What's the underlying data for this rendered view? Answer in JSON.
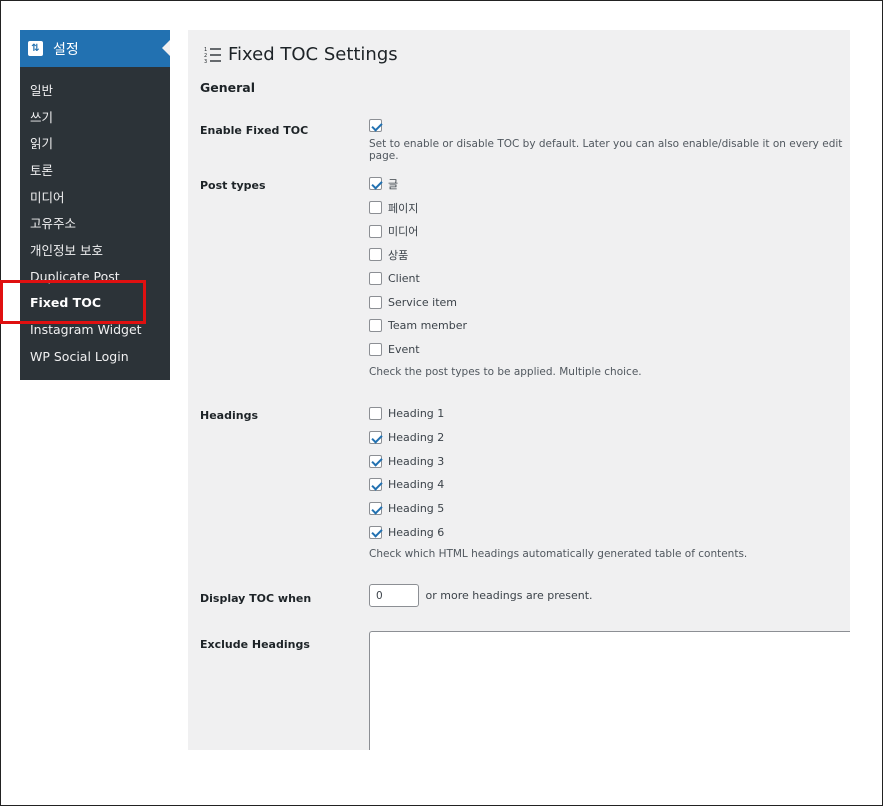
{
  "sidebar": {
    "header_label": "설정",
    "header_icon": "settings-icon",
    "items": [
      {
        "label": "일반"
      },
      {
        "label": "쓰기"
      },
      {
        "label": "읽기"
      },
      {
        "label": "토론"
      },
      {
        "label": "미디어"
      },
      {
        "label": "고유주소"
      },
      {
        "label": "개인정보 보호"
      },
      {
        "label": "Duplicate Post"
      },
      {
        "label": "Fixed TOC",
        "active": true
      },
      {
        "label": "Instagram Widget"
      },
      {
        "label": "WP Social Login"
      }
    ]
  },
  "page": {
    "title": "Fixed TOC Settings",
    "section": "General"
  },
  "enable": {
    "label": "Enable Fixed TOC",
    "checked": true,
    "desc": "Set to enable or disable TOC by default. Later you can also enable/disable it on every edit page."
  },
  "post_types": {
    "label": "Post types",
    "options": [
      {
        "label": "글",
        "checked": true
      },
      {
        "label": "페이지",
        "checked": false
      },
      {
        "label": "미디어",
        "checked": false
      },
      {
        "label": "상품",
        "checked": false
      },
      {
        "label": "Client",
        "checked": false
      },
      {
        "label": "Service item",
        "checked": false
      },
      {
        "label": "Team member",
        "checked": false
      },
      {
        "label": "Event",
        "checked": false
      }
    ],
    "desc": "Check the post types to be applied. Multiple choice."
  },
  "headings": {
    "label": "Headings",
    "options": [
      {
        "label": "Heading 1",
        "checked": false
      },
      {
        "label": "Heading 2",
        "checked": true
      },
      {
        "label": "Heading 3",
        "checked": true
      },
      {
        "label": "Heading 4",
        "checked": true
      },
      {
        "label": "Heading 5",
        "checked": true
      },
      {
        "label": "Heading 6",
        "checked": true
      }
    ],
    "desc": "Check which HTML headings automatically generated table of contents."
  },
  "display_when": {
    "label": "Display TOC when",
    "value": "0",
    "suffix": "or more headings are present."
  },
  "exclude": {
    "label": "Exclude Headings",
    "value": ""
  },
  "colors": {
    "accent": "#2271b1",
    "sidebar_bg": "#2c3338",
    "highlight_box": "#e01010"
  }
}
